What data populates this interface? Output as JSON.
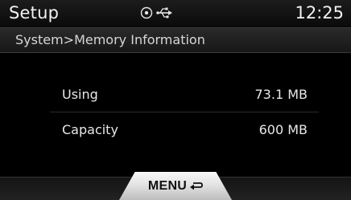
{
  "header": {
    "title": "Setup",
    "clock": "12:25",
    "icons": [
      "disc-icon",
      "usb-icon"
    ]
  },
  "breadcrumb": {
    "text": "System>Memory Information"
  },
  "memory": {
    "rows": [
      {
        "label": "Using",
        "value": "73.1 MB"
      },
      {
        "label": "Capacity",
        "value": "600 MB"
      }
    ]
  },
  "footer": {
    "menu_label": "MENU",
    "menu_icon": "return-arrow-icon"
  },
  "colors": {
    "background": "#000000",
    "text": "#e8e8e8",
    "menu_button": "#e3e3e3"
  }
}
